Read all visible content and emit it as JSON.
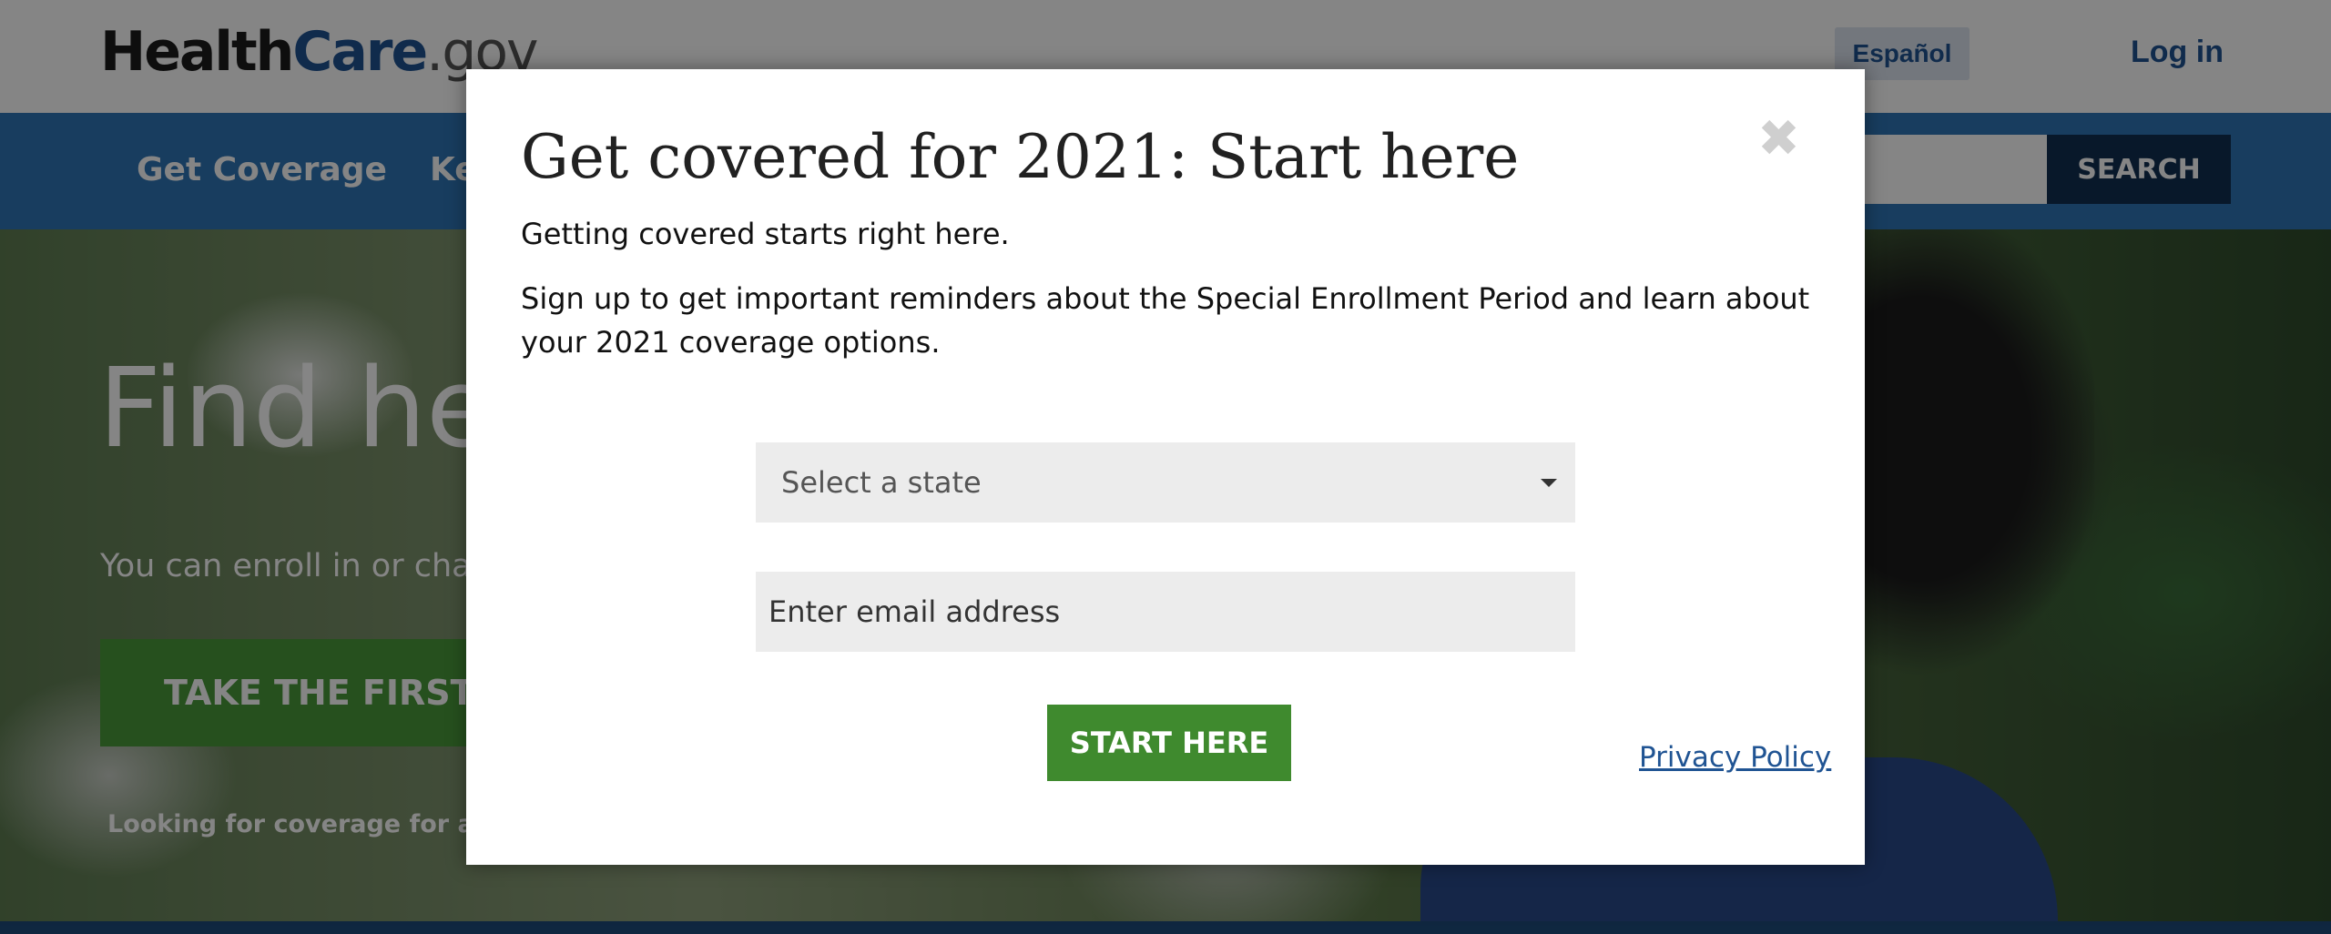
{
  "header": {
    "logo": {
      "health": "Health",
      "care": "Care",
      "gov": ".gov"
    },
    "language_label": "Español",
    "login_label": "Log in"
  },
  "nav": {
    "items": [
      "Get Coverage",
      "Ke"
    ],
    "search_button": "SEARCH"
  },
  "hero": {
    "title": "Find hea",
    "subtitle": "You can enroll in or char",
    "cta_label": "TAKE THE FIRST S",
    "small_text": "Looking for coverage for a sm"
  },
  "modal": {
    "title": "Get covered for 2021: Start here",
    "close_glyph": "✖",
    "intro": "Getting covered starts right here.",
    "description": "Sign up to get important reminders about the Special Enrollment Period and learn about your 2021 coverage options.",
    "state_select": {
      "placeholder": "Select a state"
    },
    "email": {
      "placeholder": "Enter email address",
      "value": ""
    },
    "submit_label": "START HERE",
    "privacy_link": "Privacy Policy"
  },
  "colors": {
    "brand_blue": "#205493",
    "nav_blue": "#2e75b6",
    "dark_navy": "#112e51",
    "cta_green": "#3f8a2e"
  }
}
